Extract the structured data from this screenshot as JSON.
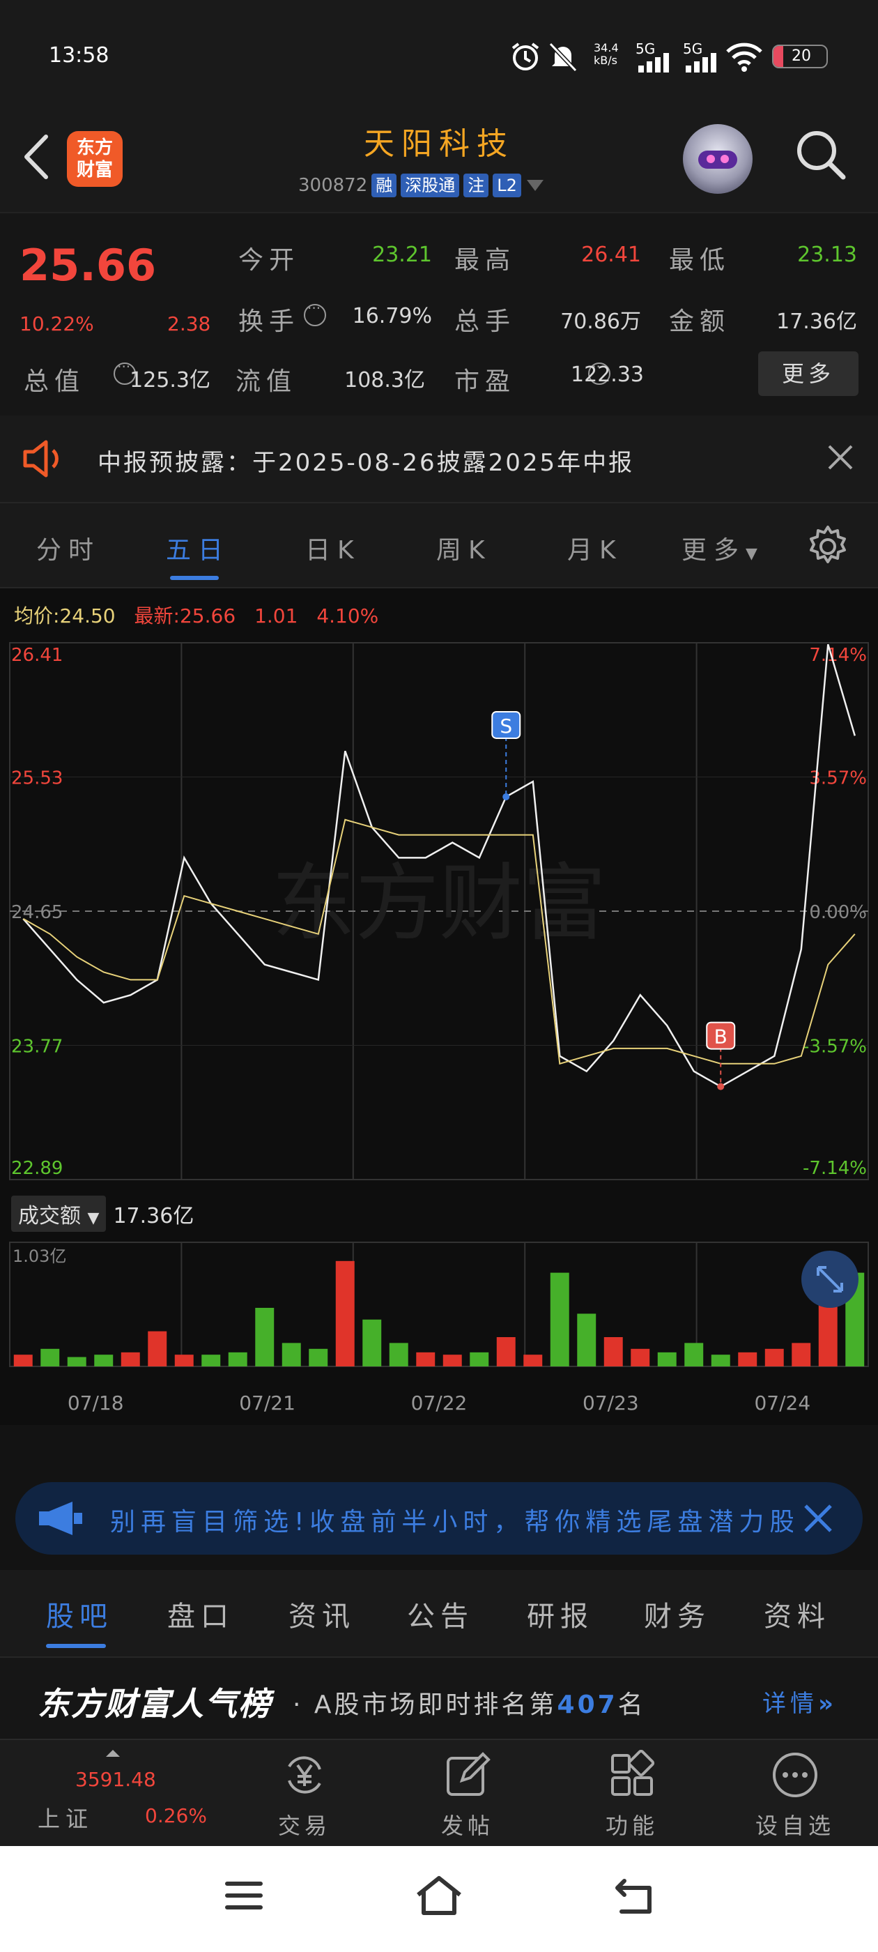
{
  "status_bar": {
    "time": "13:58",
    "net_speed": "34.4\nkB/s",
    "net1": "5G",
    "net2": "5G",
    "battery": "20"
  },
  "header": {
    "logo": "东方\n财富",
    "stock_name": "天阳科技",
    "stock_code": "300872",
    "tags": [
      "融",
      "深股通",
      "注",
      "L2"
    ]
  },
  "quote": {
    "price": "25.66",
    "change_pct": "10.22%",
    "change": "2.38",
    "rows": [
      [
        {
          "label": "今开",
          "value": "23.21",
          "color": "green"
        },
        {
          "label": "最高",
          "value": "26.41",
          "color": "red"
        },
        {
          "label": "最低",
          "value": "23.13",
          "color": "green"
        }
      ],
      [
        {
          "label": "换手",
          "value": "16.79%",
          "color": "plain"
        },
        {
          "label": "总手",
          "value": "70.86万",
          "color": "plain"
        },
        {
          "label": "金额",
          "value": "17.36亿",
          "color": "plain"
        }
      ],
      [
        {
          "label": "总值",
          "value": "125.3亿",
          "color": "plain"
        },
        {
          "label": "流值",
          "value": "108.3亿",
          "color": "plain"
        },
        {
          "label": "市盈",
          "value": "122.33",
          "color": "plain"
        }
      ]
    ],
    "more": "更多"
  },
  "notice": {
    "text": "中报预披露：于2025-08-26披露2025年中报"
  },
  "tabs": [
    "分时",
    "五日",
    "日K",
    "周K",
    "月K",
    "更多"
  ],
  "active_tab": 1,
  "legend": {
    "avg_label": "均价",
    "avg_value": "24.50",
    "latest_label": "最新",
    "latest_value": "25.66",
    "latest_chg": "1.01",
    "latest_pct": "4.10%"
  },
  "chart_data": {
    "type": "line",
    "title": "",
    "x": [
      "07/18",
      "07/21",
      "07/22",
      "07/23",
      "07/24"
    ],
    "ylim": [
      22.89,
      26.41
    ],
    "y_ticks_left": [
      "26.41",
      "25.53",
      "24.65",
      "23.77",
      "22.89"
    ],
    "y_ticks_right": [
      "7.14%",
      "3.57%",
      "0.00%",
      "-3.57%",
      "-7.14%"
    ],
    "series": [
      {
        "name": "",
        "values": [
          24.6,
          24.4,
          24.2,
          24.05,
          24.1,
          24.2,
          25.0,
          24.7,
          24.5,
          24.3,
          24.25,
          24.2,
          25.7,
          25.2,
          25.0,
          25.0,
          25.1,
          25.0,
          25.4,
          25.5,
          23.7,
          23.6,
          23.8,
          24.1,
          23.9,
          23.6,
          23.5,
          23.6,
          23.7,
          24.4,
          26.4,
          25.8
        ]
      },
      {
        "name": "",
        "values": [
          24.6,
          24.5,
          24.35,
          24.25,
          24.2,
          24.2,
          24.75,
          24.7,
          24.65,
          24.6,
          24.55,
          24.5,
          25.25,
          25.2,
          25.15,
          25.15,
          25.15,
          25.15,
          25.15,
          25.15,
          23.65,
          23.7,
          23.75,
          23.75,
          23.75,
          23.7,
          23.65,
          23.65,
          23.65,
          23.7,
          24.3,
          24.5
        ]
      }
    ],
    "markers": [
      {
        "label": "S",
        "index": 18
      },
      {
        "label": "B",
        "index": 26
      }
    ],
    "volume": {
      "label": "成交额",
      "total": "17.36亿",
      "max_label": "1.03亿",
      "values": [
        0.1,
        0.15,
        0.08,
        0.1,
        0.12,
        0.3,
        0.1,
        0.1,
        0.12,
        0.5,
        0.2,
        0.15,
        0.9,
        0.4,
        0.2,
        0.12,
        0.1,
        0.12,
        0.25,
        0.1,
        0.8,
        0.45,
        0.25,
        0.15,
        0.12,
        0.2,
        0.1,
        0.12,
        0.15,
        0.2,
        0.95,
        0.8
      ]
    }
  },
  "ad": {
    "text": "别再盲目筛选!收盘前半小时，帮你精选尾盘潜力股"
  },
  "sub_tabs": [
    "股吧",
    "盘口",
    "资讯",
    "公告",
    "研报",
    "财务",
    "资料"
  ],
  "popularity": {
    "title": "东方财富人气榜",
    "text_pre": "· A股市场即时排名第",
    "rank": "407",
    "text_post": "名",
    "detail": "详情"
  },
  "bottom_nav": {
    "index_name": "上证",
    "index_value": "3591.48",
    "index_pct": "0.26%",
    "items": [
      "交易",
      "发帖",
      "功能",
      "设自选"
    ]
  }
}
